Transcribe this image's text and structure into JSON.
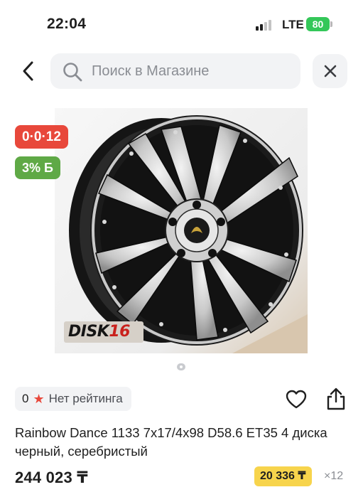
{
  "status_bar": {
    "time": "22:04",
    "network": "LTE",
    "battery": "80"
  },
  "search": {
    "placeholder": "Поиск в Магазине",
    "value": ""
  },
  "icons": {
    "back": "chevron-left-icon",
    "search": "search-icon",
    "close": "close-icon",
    "favorite": "heart-icon",
    "share": "share-icon",
    "rating_star": "star-icon"
  },
  "product": {
    "installment_badge": "0·0·12",
    "bonus_badge": "3% Б",
    "watermark": {
      "part1": "DISK",
      "part2": "16"
    },
    "gallery": {
      "current": 1,
      "total": 1
    },
    "rating": {
      "count": "0",
      "label": "Нет рейтинга"
    },
    "title": "Rainbow Dance 1133 7x17/4x98 D58.6 ET35 4 диска черный, серебристый",
    "price": "244 023 ₸",
    "installment": {
      "monthly": "20 336 ₸",
      "months": "×12"
    }
  },
  "colors": {
    "accent_red": "#e8483b",
    "bonus_green": "#5fa946",
    "installment_yellow": "#f7d44c",
    "battery_green": "#34c759",
    "surface_gray": "#f2f3f5"
  }
}
